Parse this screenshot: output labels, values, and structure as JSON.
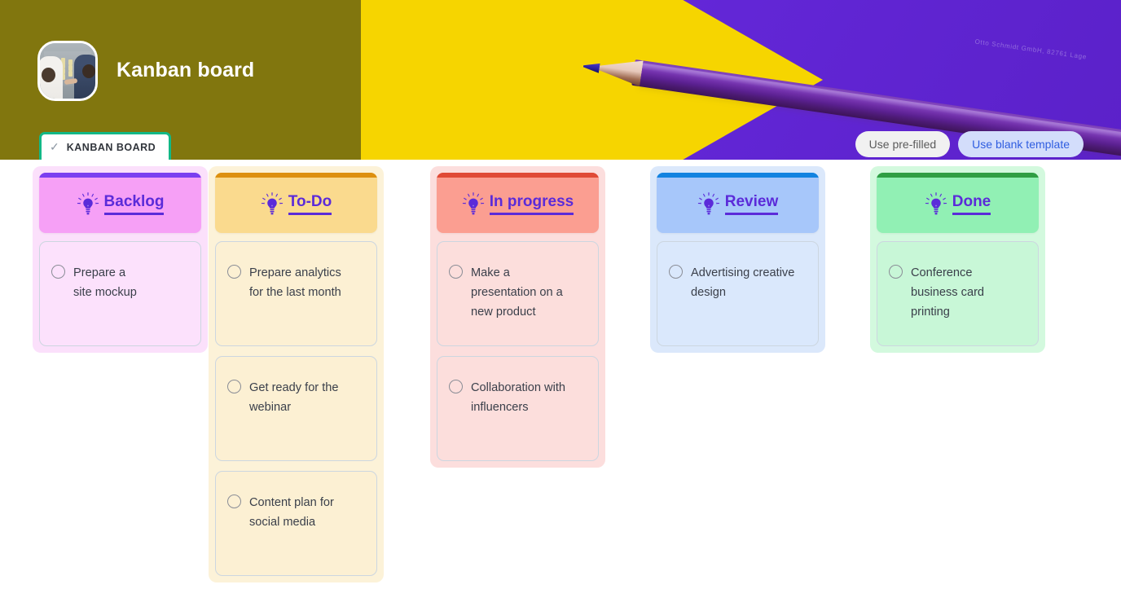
{
  "header": {
    "title": "Kanban board",
    "avatar_alt": "kanban-board-photo",
    "barrel_text": "Otto Schmidt GmbH, 82761 Lage",
    "buttons": {
      "secondary": "Use pre-filled",
      "primary": "Use blank template"
    },
    "tab": {
      "check_icon": "check-icon",
      "label": "KANBAN BOARD"
    },
    "colors": {
      "banner_left": "#81760e",
      "banner_yellow": "#f6d500",
      "banner_purple": "#6226d6",
      "tab_accent": "#12b886",
      "primary_button_text": "#2f5de0",
      "primary_button_bg": "#d3ddfb"
    }
  },
  "board": {
    "columns": [
      {
        "title": "Backlog",
        "icon": "lightbulb-icon",
        "accent": "#7b3ff0",
        "header_bg": "#f6a0f6",
        "column_bg": "#fbe0fb",
        "card_bg": "#fce1fc",
        "cards": [
          {
            "text": "Prepare a\nsite mockup",
            "checkbox": "unchecked-circle-icon"
          }
        ]
      },
      {
        "title": "To-Do",
        "icon": "lightbulb-icon",
        "accent": "#dd9010",
        "header_bg": "#fada8e",
        "column_bg": "#fcf2d8",
        "card_bg": "#fcf0d3",
        "cards": [
          {
            "text": "Prepare analytics\nfor the last month",
            "checkbox": "unchecked-circle-icon"
          },
          {
            "text": "Get ready for the\nwebinar",
            "checkbox": "unchecked-circle-icon"
          },
          {
            "text": "Content plan for\nsocial media",
            "checkbox": "unchecked-circle-icon"
          }
        ]
      },
      {
        "title": "In progress",
        "icon": "lightbulb-icon",
        "accent": "#e04a36",
        "header_bg": "#fb9e91",
        "column_bg": "#fcdedd",
        "card_bg": "#fcdedc",
        "cards": [
          {
            "text": "Make a\npresentation on a\nnew product",
            "checkbox": "unchecked-circle-icon"
          },
          {
            "text": "Collaboration with\ninfluencers",
            "checkbox": "unchecked-circle-icon"
          }
        ]
      },
      {
        "title": "Review",
        "icon": "lightbulb-icon",
        "accent": "#1383e0",
        "header_bg": "#a7c7fa",
        "column_bg": "#dbe8fb",
        "card_bg": "#dae8fc",
        "cards": [
          {
            "text": "Advertising creative\ndesign",
            "checkbox": "unchecked-circle-icon"
          }
        ]
      },
      {
        "title": "Done",
        "icon": "lightbulb-icon",
        "accent": "#2f9e44",
        "header_bg": "#91f0b4",
        "column_bg": "#d3f9de",
        "card_bg": "#c8f7d7",
        "cards": [
          {
            "text": "Conference\nbusiness card\nprinting",
            "checkbox": "unchecked-circle-icon"
          }
        ]
      }
    ]
  }
}
